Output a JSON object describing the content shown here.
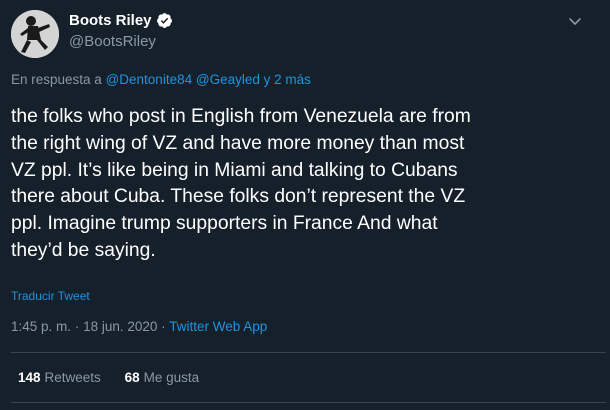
{
  "author": {
    "name": "Boots Riley",
    "handle": "@BootsRiley",
    "verified": true
  },
  "icons": {
    "verified": "verified-badge-icon",
    "menu": "chevron-down-icon"
  },
  "reply": {
    "prefix": "En respuesta a",
    "mention1": "@Dentonite84",
    "mention2": "@Geayled",
    "more": "y 2 más"
  },
  "tweet": {
    "lines": [
      "the folks who post in English from Venezuela are from",
      "the right wing of VZ and have more money than most",
      "VZ ppl. It’s like being in Miami and talking to Cubans",
      "there about Cuba. These folks don’t represent the VZ",
      "ppl. Imagine trump supporters in France And what",
      "they’d be saying."
    ],
    "translate": "Traducir Tweet",
    "time": "1:45 p. m.",
    "date": "18 jun. 2020",
    "source": "Twitter Web App",
    "separator": "·"
  },
  "stats": {
    "retweets_count": "148",
    "retweets_label": "Retweets",
    "likes_count": "68",
    "likes_label": "Me gusta"
  },
  "colors": {
    "background": "#15202b",
    "link": "#1b95e0",
    "muted": "#8899a6",
    "divider": "#38444d"
  }
}
